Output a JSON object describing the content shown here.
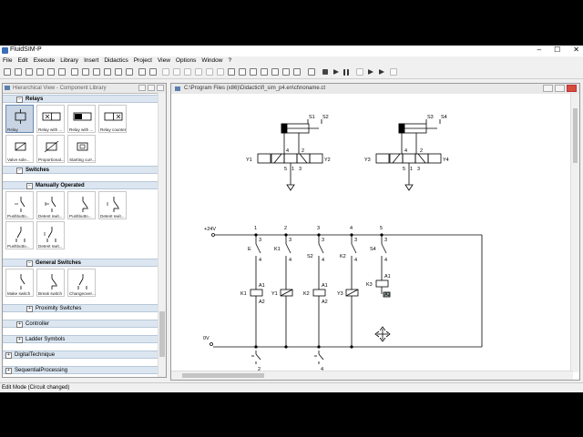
{
  "window": {
    "title": "FluidSIM-P",
    "controls": [
      "–",
      "☐",
      "✕"
    ]
  },
  "menu": [
    "File",
    "Edit",
    "Execute",
    "Library",
    "Insert",
    "Didactics",
    "Project",
    "View",
    "Options",
    "Window",
    "?"
  ],
  "library_panel": {
    "title": "Hierarchical View - Component Library",
    "sections": {
      "relays": "Relays",
      "switches": "Switches",
      "manual": "Manually Operated",
      "general": "General Switches",
      "proximity": "Proximity Switches",
      "controller": "Controller",
      "ladder": "Ladder Symbols",
      "digital": "DigitalTechnique",
      "last": "SequentialProcessing"
    },
    "relay_items": [
      "Relay",
      "Relay with ...",
      "Relay with ...",
      "Relay counter",
      "Valve sole...",
      "Proportional...",
      "Starting curr..."
    ],
    "manual_items": [
      "Pushbutto...",
      "Detent swit...",
      "Pushbutto...",
      "Detent swit...",
      "Pushbutto...",
      "Detent swit..."
    ],
    "general_items": [
      "Make switch",
      "Break switch",
      "Changeover..."
    ]
  },
  "diagram": {
    "title": "C:\\Program Files (x86)\\Didactic\\fl_sim_p4.en\\ct\\noname.ct",
    "cyl_labels": [
      "S1",
      "S2",
      "S3",
      "S4"
    ],
    "valve_labels": [
      "Y1",
      "Y2",
      "Y3",
      "Y4"
    ],
    "port_labels": [
      "4",
      "2",
      "5",
      "1",
      "3"
    ],
    "supply_pos": "+24V",
    "supply_neg": "0V",
    "rung_numbers": [
      "1",
      "2",
      "3",
      "4",
      "5"
    ],
    "contact_labels": [
      "E",
      "K1",
      "S2",
      "K2",
      "S4"
    ],
    "contact_pins": [
      "3",
      "4"
    ],
    "coil_labels": [
      "K1",
      "Y1",
      "K2",
      "Y3",
      "K3"
    ],
    "coil_pins": [
      "A1",
      "A2"
    ],
    "bottom_labels": [
      "2",
      "4"
    ]
  },
  "status": {
    "text": "Edit Mode (Circuit changed)"
  }
}
